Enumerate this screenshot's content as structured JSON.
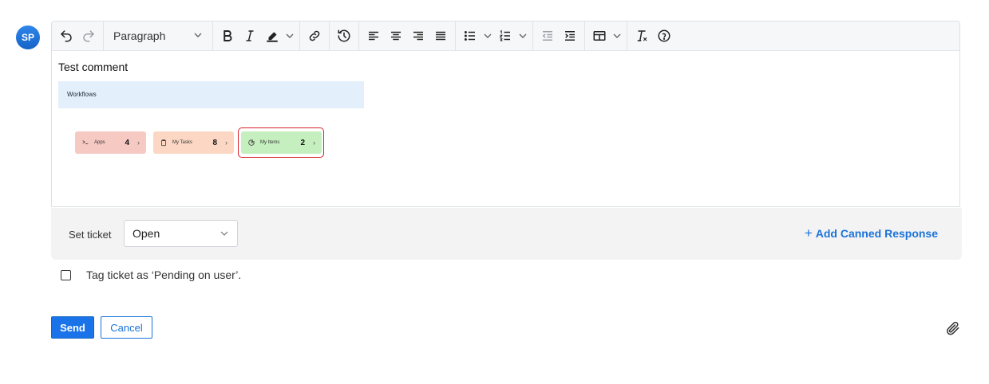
{
  "avatar": {
    "initials": "SP"
  },
  "toolbar": {
    "block_format": "Paragraph"
  },
  "editor": {
    "comment_text": "Test comment",
    "image": {
      "title": "Workflows",
      "cards": [
        {
          "label": "Apps",
          "count": "4"
        },
        {
          "label": "My Tasks",
          "count": "8"
        },
        {
          "label": "My Items",
          "count": "2"
        }
      ]
    }
  },
  "ticket": {
    "set_label": "Set ticket",
    "status_value": "Open",
    "canned_label": "Add Canned Response"
  },
  "tag": {
    "label": "Tag ticket as ‘Pending on user’."
  },
  "actions": {
    "send_label": "Send",
    "cancel_label": "Cancel"
  },
  "colors": {
    "accent": "#1a73e8",
    "highlight": "#d9222a"
  }
}
